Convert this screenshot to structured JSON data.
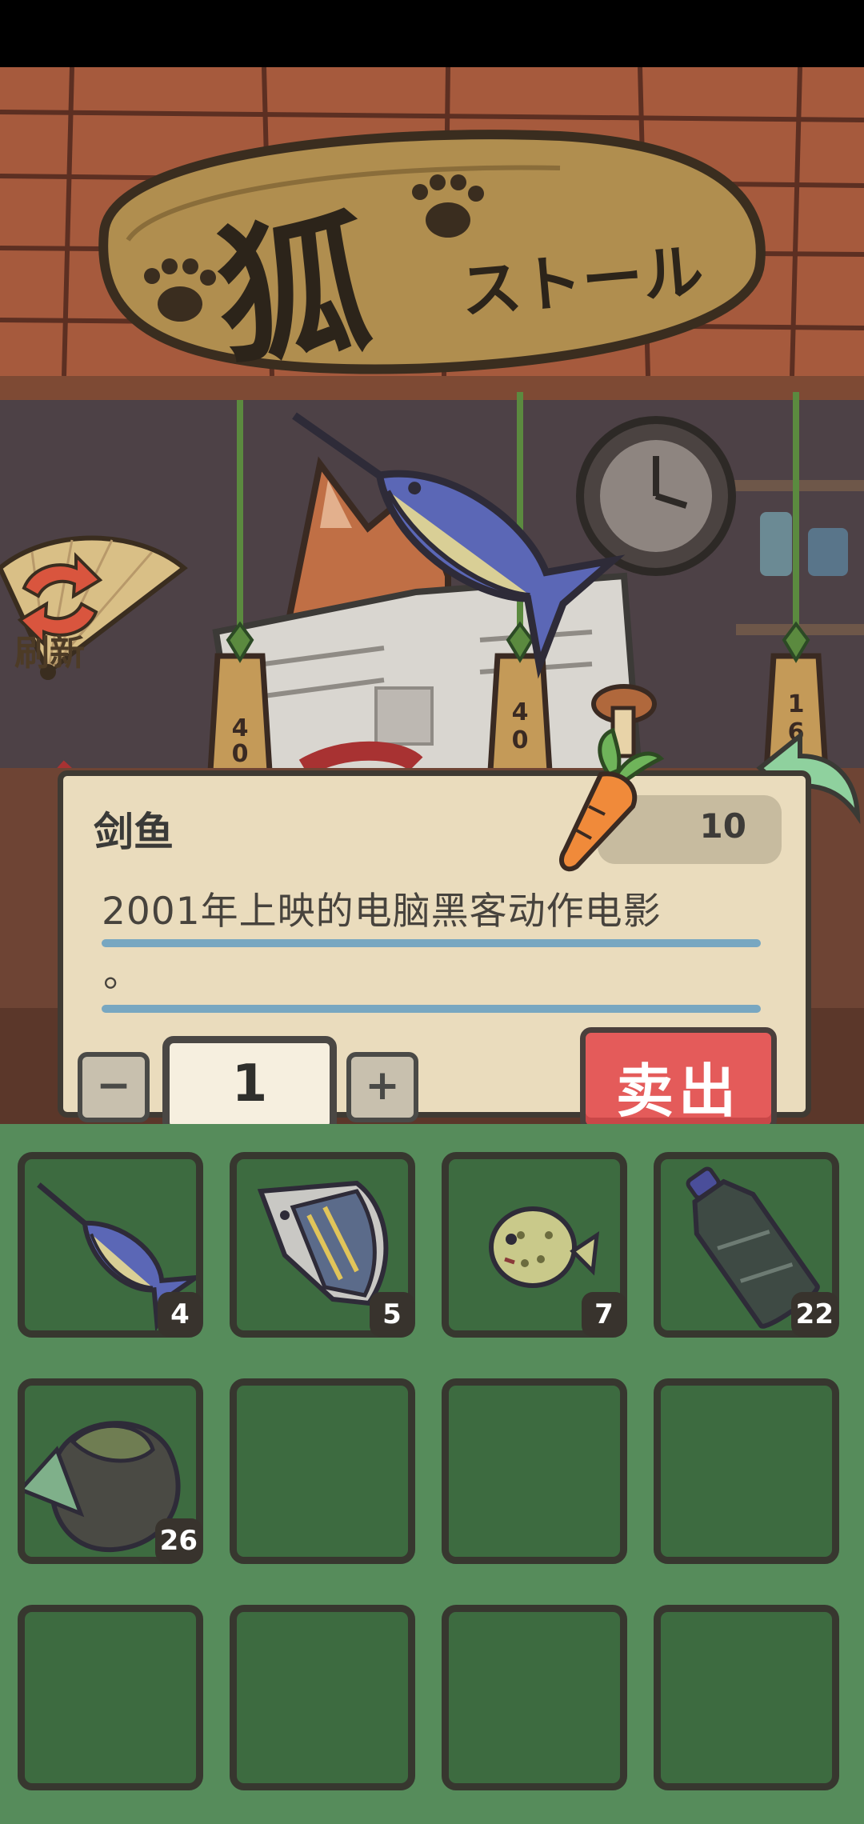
{
  "shop_sign": {
    "main": "狐",
    "sub": "ストール"
  },
  "refresh_button": {
    "label": "刷新",
    "icon": "refresh-arrows-icon"
  },
  "item": {
    "name": "剑鱼",
    "price": "10",
    "currency_icon": "carrot-icon",
    "description_line1": "2001年上映的电脑黑客动作电影",
    "description_line2": "。"
  },
  "quantity": {
    "value": "1",
    "minus": "−",
    "plus": "+"
  },
  "sell_button": {
    "label": "卖出"
  },
  "back_button": {
    "icon": "back-arrow-icon"
  },
  "inventory": {
    "slots": [
      {
        "item": "swordfish",
        "count": "4"
      },
      {
        "item": "triggerfish",
        "count": "5"
      },
      {
        "item": "pufferfish",
        "count": "7"
      },
      {
        "item": "plastic-bottle",
        "count": "22"
      },
      {
        "item": "trash-bag",
        "count": "26"
      },
      {
        "item": "",
        "count": ""
      },
      {
        "item": "",
        "count": ""
      },
      {
        "item": "",
        "count": ""
      },
      {
        "item": "",
        "count": ""
      },
      {
        "item": "",
        "count": ""
      },
      {
        "item": "",
        "count": ""
      },
      {
        "item": "",
        "count": ""
      }
    ]
  },
  "colors": {
    "wood": "#a65a3d",
    "card": "#eadcbd",
    "sell": "#e45b5a",
    "inventory_bg": "#568c5b",
    "slot_bg": "#3d6b40"
  }
}
